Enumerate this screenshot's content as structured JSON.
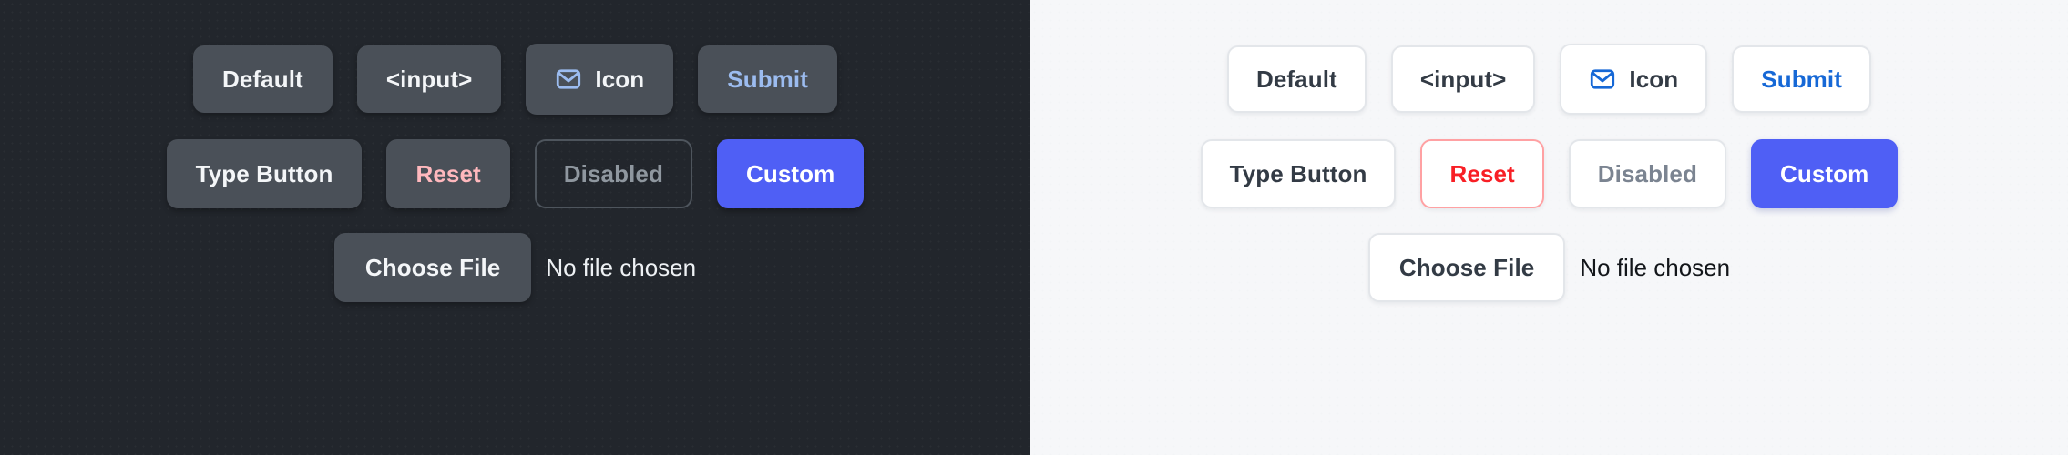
{
  "panels": [
    {
      "theme": "dark",
      "background": "#22262c",
      "rows": [
        {
          "buttons": [
            {
              "label": "Default",
              "variant": "default",
              "icon": null
            },
            {
              "label": "<input>",
              "variant": "default",
              "icon": null
            },
            {
              "label": "Icon",
              "variant": "default",
              "icon": "envelope-icon"
            },
            {
              "label": "Submit",
              "variant": "submit",
              "icon": null
            }
          ]
        },
        {
          "buttons": [
            {
              "label": "Type Button",
              "variant": "default",
              "icon": null
            },
            {
              "label": "Reset",
              "variant": "reset",
              "icon": null
            },
            {
              "label": "Disabled",
              "variant": "disabled",
              "icon": null
            },
            {
              "label": "Custom",
              "variant": "custom",
              "icon": null
            }
          ]
        }
      ],
      "file_input": {
        "button_label": "Choose File",
        "status_text": "No file chosen"
      }
    },
    {
      "theme": "light",
      "background": "#f6f7f9",
      "rows": [
        {
          "buttons": [
            {
              "label": "Default",
              "variant": "default",
              "icon": null
            },
            {
              "label": "<input>",
              "variant": "default",
              "icon": null
            },
            {
              "label": "Icon",
              "variant": "default",
              "icon": "envelope-icon"
            },
            {
              "label": "Submit",
              "variant": "submit",
              "icon": null
            }
          ]
        },
        {
          "buttons": [
            {
              "label": "Type Button",
              "variant": "default",
              "icon": null
            },
            {
              "label": "Reset",
              "variant": "reset",
              "icon": null
            },
            {
              "label": "Disabled",
              "variant": "disabled",
              "icon": null
            },
            {
              "label": "Custom",
              "variant": "custom",
              "icon": null
            }
          ]
        }
      ],
      "file_input": {
        "button_label": "Choose File",
        "status_text": "No file chosen"
      }
    }
  ],
  "colors": {
    "dark_panel_bg": "#22262c",
    "dark_button_bg": "#4a5058",
    "dark_button_text": "#f4f6f8",
    "dark_submit_text": "#9cbcf0",
    "dark_reset_text": "#ffb8bd",
    "dark_disabled_text": "#8f979f",
    "light_panel_bg": "#f6f7f9",
    "light_button_bg": "#ffffff",
    "light_button_border": "#e3e6ea",
    "light_button_text": "#333b45",
    "light_submit_text": "#1668d6",
    "light_reset_text": "#f81f25",
    "light_reset_border": "#ffa1a3",
    "light_disabled_text": "#7b8491",
    "custom_accent": "#4f5ff5"
  }
}
